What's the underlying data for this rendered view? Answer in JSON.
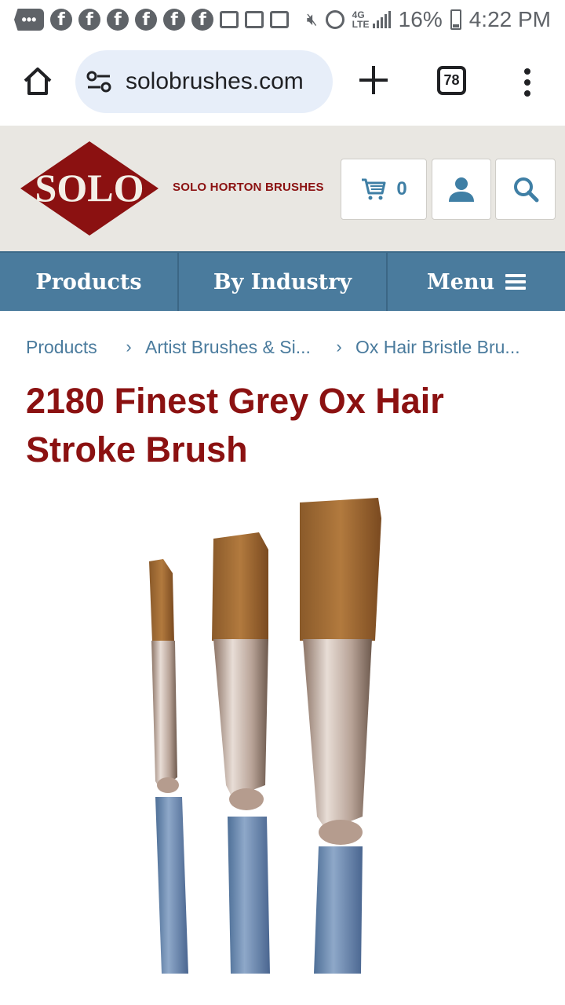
{
  "status_bar": {
    "battery": "16%",
    "time": "4:22 PM",
    "network": "4G LTE",
    "messages_icon_label": "•••",
    "facebook_glyph": "f"
  },
  "browser": {
    "url": "solobrushes.com",
    "tab_count": "78"
  },
  "site_header": {
    "brand_name": "SOLO HORTON BRUSHES",
    "logo_text": "SOLO",
    "cart_count": "0"
  },
  "nav": {
    "products": "Products",
    "by_industry": "By Industry",
    "menu": "Menu"
  },
  "breadcrumb": {
    "separator": "›",
    "items": [
      "Products",
      "Artist Brushes & Si...",
      "Ox Hair Bristle Bru..."
    ]
  },
  "product": {
    "title": "2180 Finest Grey Ox Hair Stroke Brush"
  },
  "colors": {
    "brand_red": "#8b1111",
    "nav_blue": "#4a7b9d",
    "header_bg": "#e9e7e2",
    "url_pill": "#e7eef9"
  },
  "icons": [
    "home-icon",
    "tune-icon",
    "plus-icon",
    "tabs-icon",
    "more-vert-icon",
    "cart-icon",
    "account-icon",
    "search-icon",
    "hamburger-icon"
  ]
}
